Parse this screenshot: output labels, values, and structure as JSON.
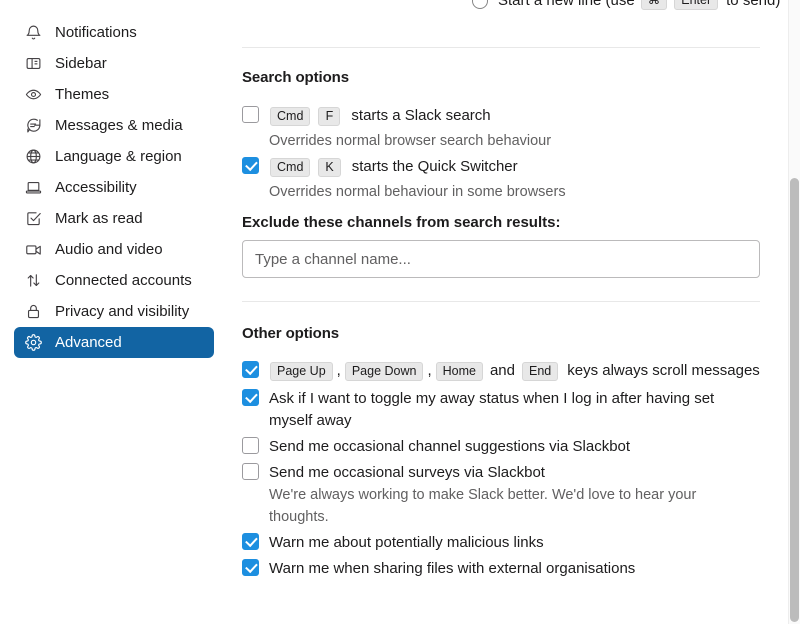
{
  "sidebar": {
    "items": [
      {
        "label": "Notifications",
        "icon": "bell-icon",
        "active": false
      },
      {
        "label": "Sidebar",
        "icon": "sidebar-panel-icon",
        "active": false
      },
      {
        "label": "Themes",
        "icon": "eye-icon",
        "active": false
      },
      {
        "label": "Messages & media",
        "icon": "message-bubble-icon",
        "active": false
      },
      {
        "label": "Language & region",
        "icon": "globe-icon",
        "active": false
      },
      {
        "label": "Accessibility",
        "icon": "laptop-icon",
        "active": false
      },
      {
        "label": "Mark as read",
        "icon": "check-square-icon",
        "active": false
      },
      {
        "label": "Audio and video",
        "icon": "video-camera-icon",
        "active": false
      },
      {
        "label": "Connected accounts",
        "icon": "arrows-up-down-icon",
        "active": false
      },
      {
        "label": "Privacy and visibility",
        "icon": "lock-icon",
        "active": false
      },
      {
        "label": "Advanced",
        "icon": "gear-icon",
        "active": true
      }
    ]
  },
  "content": {
    "cutoff_row": {
      "text_before": "Start a new line (use",
      "key_cmd": "⌘",
      "key_enter": "Enter",
      "text_after": "to send)"
    },
    "search_options": {
      "heading": "Search options",
      "items": [
        {
          "checked": false,
          "key1": "Cmd",
          "key2": "F",
          "label": "starts a Slack search",
          "sub": "Overrides normal browser search behaviour"
        },
        {
          "checked": true,
          "key1": "Cmd",
          "key2": "K",
          "label": "starts the Quick Switcher",
          "sub": "Overrides normal behaviour in some browsers"
        }
      ]
    },
    "exclude_channels": {
      "label": "Exclude these channels from search results:",
      "placeholder": "Type a channel name...",
      "value": ""
    },
    "other_options": {
      "heading": "Other options",
      "scroll_keys_row": {
        "checked": true,
        "key1": "Page Up",
        "sep1": ",",
        "key2": "Page Down",
        "sep2": ",",
        "key3": "Home",
        "conjunction": "and",
        "key4": "End",
        "label": "keys always scroll messages"
      },
      "items": [
        {
          "checked": true,
          "label": "Ask if I want to toggle my away status when I log in after having set myself away",
          "sub": ""
        },
        {
          "checked": false,
          "label": "Send me occasional channel suggestions via Slackbot",
          "sub": ""
        },
        {
          "checked": false,
          "label": "Send me occasional surveys via Slackbot",
          "sub": "We're always working to make Slack better. We'd love to hear your thoughts."
        },
        {
          "checked": true,
          "label": "Warn me about potentially malicious links",
          "sub": ""
        },
        {
          "checked": true,
          "label": "Warn me when sharing files with external organisations",
          "sub": ""
        }
      ]
    }
  },
  "colors": {
    "accent": "#1264a3",
    "checkbox_on": "#1d8fe0",
    "text": "#1d1c1d",
    "muted_text": "#616061",
    "divider": "#e8e8e8"
  }
}
